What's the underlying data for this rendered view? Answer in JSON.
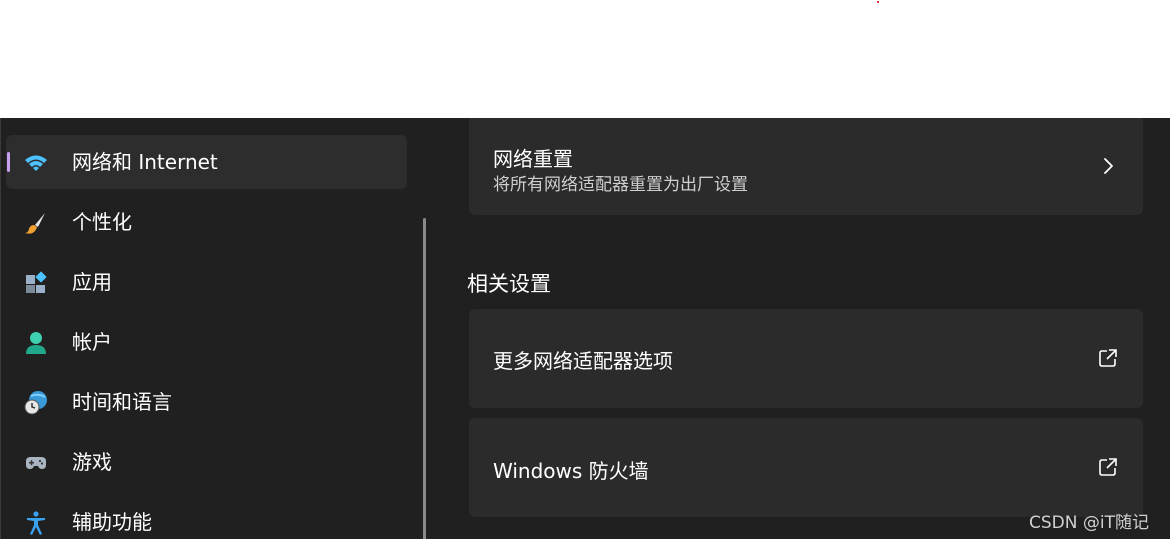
{
  "sidebar": {
    "items": [
      {
        "label": "网络和 Internet",
        "icon": "wifi-icon",
        "active": true
      },
      {
        "label": "个性化",
        "icon": "paintbrush-icon",
        "active": false
      },
      {
        "label": "应用",
        "icon": "apps-icon",
        "active": false
      },
      {
        "label": "帐户",
        "icon": "account-icon",
        "active": false
      },
      {
        "label": "时间和语言",
        "icon": "globe-clock-icon",
        "active": false
      },
      {
        "label": "游戏",
        "icon": "gamepad-icon",
        "active": false
      },
      {
        "label": "辅助功能",
        "icon": "accessibility-icon",
        "active": false
      }
    ]
  },
  "main": {
    "network_reset": {
      "title": "网络重置",
      "subtitle": "将所有网络适配器重置为出厂设置",
      "icon": "chevron-right-icon"
    },
    "related_settings": {
      "heading": "相关设置",
      "items": [
        {
          "label": "更多网络适配器选项",
          "icon": "external-link-icon"
        },
        {
          "label": "Windows 防火墙",
          "icon": "external-link-icon"
        }
      ]
    }
  },
  "watermark": "CSDN @iT随记",
  "colors": {
    "background": "#202020",
    "card": "#2b2b2b",
    "active_item": "#2d2d2d",
    "accent_indicator": "#c8a0f0"
  }
}
